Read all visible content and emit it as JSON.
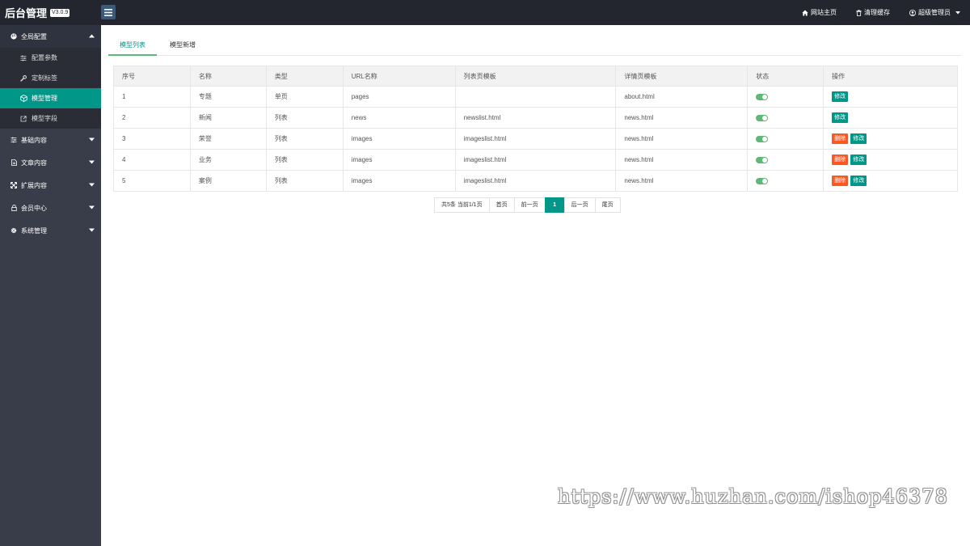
{
  "header": {
    "logo": "后台管理",
    "version": "V3.0.9",
    "links": [
      {
        "icon": "home-icon",
        "label": "网站主页"
      },
      {
        "icon": "trash-icon",
        "label": "清理缓存"
      },
      {
        "icon": "user-icon",
        "label": "超级管理员"
      }
    ]
  },
  "sidebar": {
    "groups": [
      {
        "icon": "globe-icon",
        "label": "全局配置",
        "open": true
      },
      {
        "icon": "sliders-icon",
        "label": "基础内容"
      },
      {
        "icon": "document-icon",
        "label": "文章内容"
      },
      {
        "icon": "expand-icon",
        "label": "扩展内容"
      },
      {
        "icon": "lock-icon",
        "label": "会员中心"
      },
      {
        "icon": "gear-icon",
        "label": "系统管理"
      }
    ],
    "subitems": [
      {
        "icon": "sliders-icon",
        "label": "配置参数"
      },
      {
        "icon": "wrench-icon",
        "label": "定制标签"
      },
      {
        "icon": "cube-icon",
        "label": "模型管理",
        "active": true
      },
      {
        "icon": "external-link-icon",
        "label": "模型字段"
      }
    ]
  },
  "tabs": [
    {
      "label": "模型列表",
      "active": true
    },
    {
      "label": "模型新增"
    }
  ],
  "table": {
    "columns": [
      "序号",
      "名称",
      "类型",
      "URL名称",
      "列表页模板",
      "详情页模板",
      "状态",
      "操作"
    ],
    "rows": [
      {
        "id": "1",
        "name": "专题",
        "type": "单页",
        "url": "pages",
        "list_tpl": "",
        "detail_tpl": "about.html",
        "status_on": true,
        "actions": [
          "修改"
        ]
      },
      {
        "id": "2",
        "name": "新闻",
        "type": "列表",
        "url": "news",
        "list_tpl": "newslist.html",
        "detail_tpl": "news.html",
        "status_on": true,
        "actions": [
          "修改"
        ]
      },
      {
        "id": "3",
        "name": "荣誉",
        "type": "列表",
        "url": "images",
        "list_tpl": "imageslist.html",
        "detail_tpl": "news.html",
        "status_on": true,
        "actions": [
          "删除",
          "修改"
        ]
      },
      {
        "id": "4",
        "name": "业务",
        "type": "列表",
        "url": "images",
        "list_tpl": "imageslist.html",
        "detail_tpl": "news.html",
        "status_on": true,
        "actions": [
          "删除",
          "修改"
        ]
      },
      {
        "id": "5",
        "name": "案例",
        "type": "列表",
        "url": "images",
        "list_tpl": "imageslist.html",
        "detail_tpl": "news.html",
        "status_on": true,
        "actions": [
          "删除",
          "修改"
        ]
      }
    ]
  },
  "pagination": {
    "info": "共5条 当前1/1页",
    "first": "首页",
    "prev": "前一页",
    "current": "1",
    "next": "后一页",
    "last": "尾页"
  },
  "watermark": "https://www.huzhan.com/ishop46378",
  "colors": {
    "topbar": "#23262e",
    "sidebar": "#393d49",
    "accent": "#009688",
    "danger": "#ff5722",
    "switch_on": "#5fb878"
  }
}
